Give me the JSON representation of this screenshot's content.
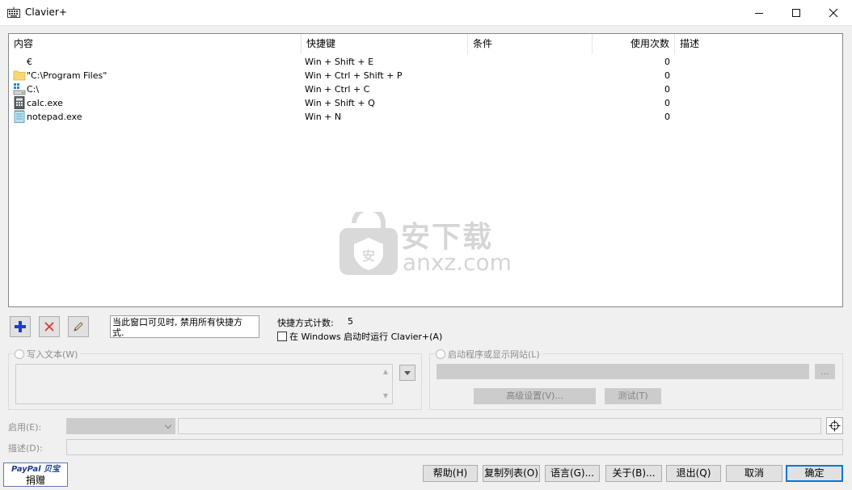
{
  "window": {
    "title": "Clavier+"
  },
  "list": {
    "columns": [
      "内容",
      "快捷键",
      "条件",
      "使用次数",
      "描述"
    ],
    "rows": [
      {
        "icon": "euro-icon",
        "content": "€",
        "shortcut": "Win + Shift + E",
        "condition": "",
        "count": "0",
        "description": ""
      },
      {
        "icon": "folder-icon",
        "content": "\"C:\\Program Files\"",
        "shortcut": "Win + Ctrl + Shift + P",
        "condition": "",
        "count": "0",
        "description": ""
      },
      {
        "icon": "drive-icon",
        "content": "C:\\",
        "shortcut": "Win + Ctrl + C",
        "condition": "",
        "count": "0",
        "description": ""
      },
      {
        "icon": "calculator-icon",
        "content": "calc.exe",
        "shortcut": "Win + Shift + Q",
        "condition": "",
        "count": "0",
        "description": ""
      },
      {
        "icon": "notepad-icon",
        "content": "notepad.exe",
        "shortcut": "Win + N",
        "condition": "",
        "count": "0",
        "description": ""
      }
    ]
  },
  "watermark": {
    "cn": "安下载",
    "en": "anxz.com"
  },
  "toolbar": {
    "status_line1": "当此窗口可见时, 禁用所有快捷方",
    "status_line2": "式.",
    "count_label": "快捷方式计数:",
    "count_value": "5",
    "autostart_label": "在 Windows 启动时运行 Clavier+(A)"
  },
  "write_text": {
    "label": "写入文本(W)"
  },
  "launch": {
    "label": "启动程序或显示网站(L)",
    "browse_label": "...",
    "advanced_label": "高级设置(V)...",
    "test_label": "测试(T)"
  },
  "enable": {
    "label": "启用(E):"
  },
  "describe": {
    "label": "描述(D):"
  },
  "paypal": {
    "logo": "PayPal 贝宝",
    "label": "捐赠"
  },
  "buttons": {
    "help": "帮助(H)",
    "copy_list": "复制列表(O)",
    "language": "语言(G)...",
    "about": "关于(B)...",
    "exit": "退出(Q)",
    "cancel": "取消",
    "ok": "确定"
  },
  "colors": {
    "accent": "#0078d7",
    "add_blue": "#1a3fcf",
    "delete_red": "#d93025"
  }
}
